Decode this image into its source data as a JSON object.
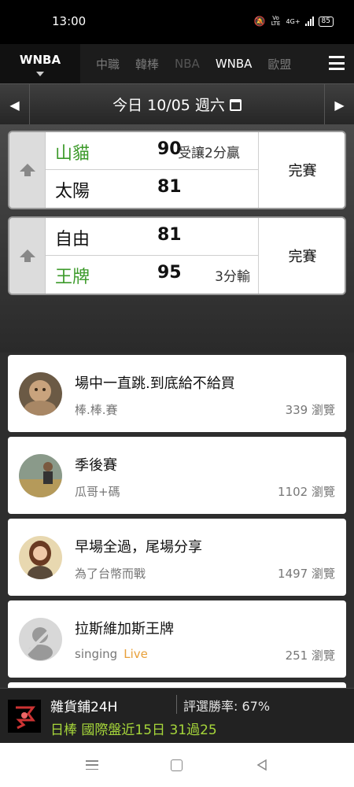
{
  "status_bar": {
    "time": "13:00",
    "network": "4G+",
    "volte": "Vo LTE",
    "battery": "85"
  },
  "tabs": {
    "active": "WNBA",
    "items": [
      "中職",
      "韓棒",
      "NBA",
      "WNBA",
      "歐盟"
    ]
  },
  "date_bar": {
    "label": "今日 10/05 週六",
    "prev": "◀",
    "next": "▶"
  },
  "games": [
    {
      "home": {
        "name": "山貓",
        "score": "90",
        "note": "受讓2分贏"
      },
      "away": {
        "name": "太陽",
        "score": "81",
        "note": ""
      },
      "status": "完賽"
    },
    {
      "home": {
        "name": "自由",
        "score": "81",
        "note": ""
      },
      "away": {
        "name": "王牌",
        "score": "95",
        "note": "3分輸"
      },
      "status": "完賽"
    }
  ],
  "posts": [
    {
      "title": "場中一直跳.到底給不給買",
      "author": "棒.棒.賽",
      "live": "",
      "views": "339 瀏覽"
    },
    {
      "title": "季後賽",
      "author": "瓜哥+碼",
      "live": "",
      "views": "1102 瀏覽"
    },
    {
      "title": "早場全過，尾場分享",
      "author": "為了台幣而戰",
      "live": "",
      "views": "1497 瀏覽"
    },
    {
      "title": "拉斯維加斯王牌",
      "author": "singing",
      "live": "Live",
      "views": "251 瀏覽"
    }
  ],
  "info_bar": {
    "shop": "雜貨鋪24H",
    "win_rate": "評選勝率: 67%",
    "highlight": "日棒 國際盤近15日 31過25"
  },
  "colors": {
    "win_green": "#3c9a2a",
    "live_orange": "#e8a03a",
    "highlight_green": "#a6d63a"
  }
}
